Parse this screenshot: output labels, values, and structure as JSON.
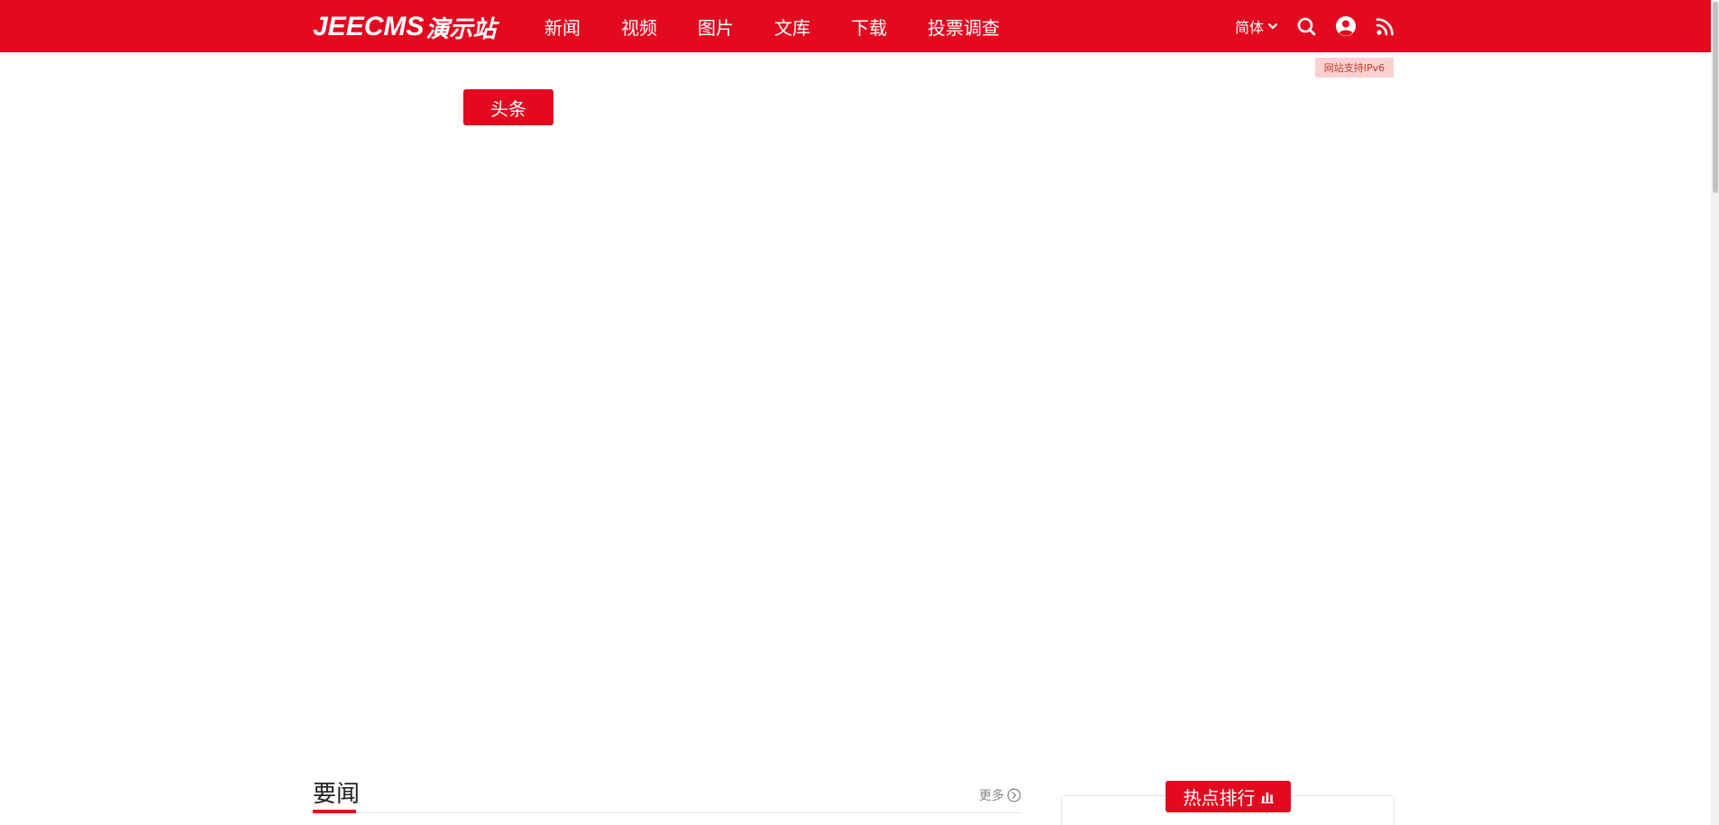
{
  "header": {
    "logo_latin": "JEECMS",
    "logo_cjk": "演示站",
    "nav": [
      {
        "label": "新闻"
      },
      {
        "label": "视频"
      },
      {
        "label": "图片"
      },
      {
        "label": "文库"
      },
      {
        "label": "下载"
      },
      {
        "label": "投票调查"
      }
    ],
    "language": "简体",
    "icons": [
      "search-icon",
      "user-icon",
      "rss-icon"
    ]
  },
  "ipv6_badge": "网站支持IPv6",
  "headline_tag": "头条",
  "news_section": {
    "title": "要闻",
    "more_label": "更多"
  },
  "hot_ranking": {
    "label": "热点排行"
  },
  "colors": {
    "brand_red": "#e30a1f",
    "badge_bg": "#fbd0d0",
    "text_dark": "#222222",
    "text_muted": "#888888"
  }
}
